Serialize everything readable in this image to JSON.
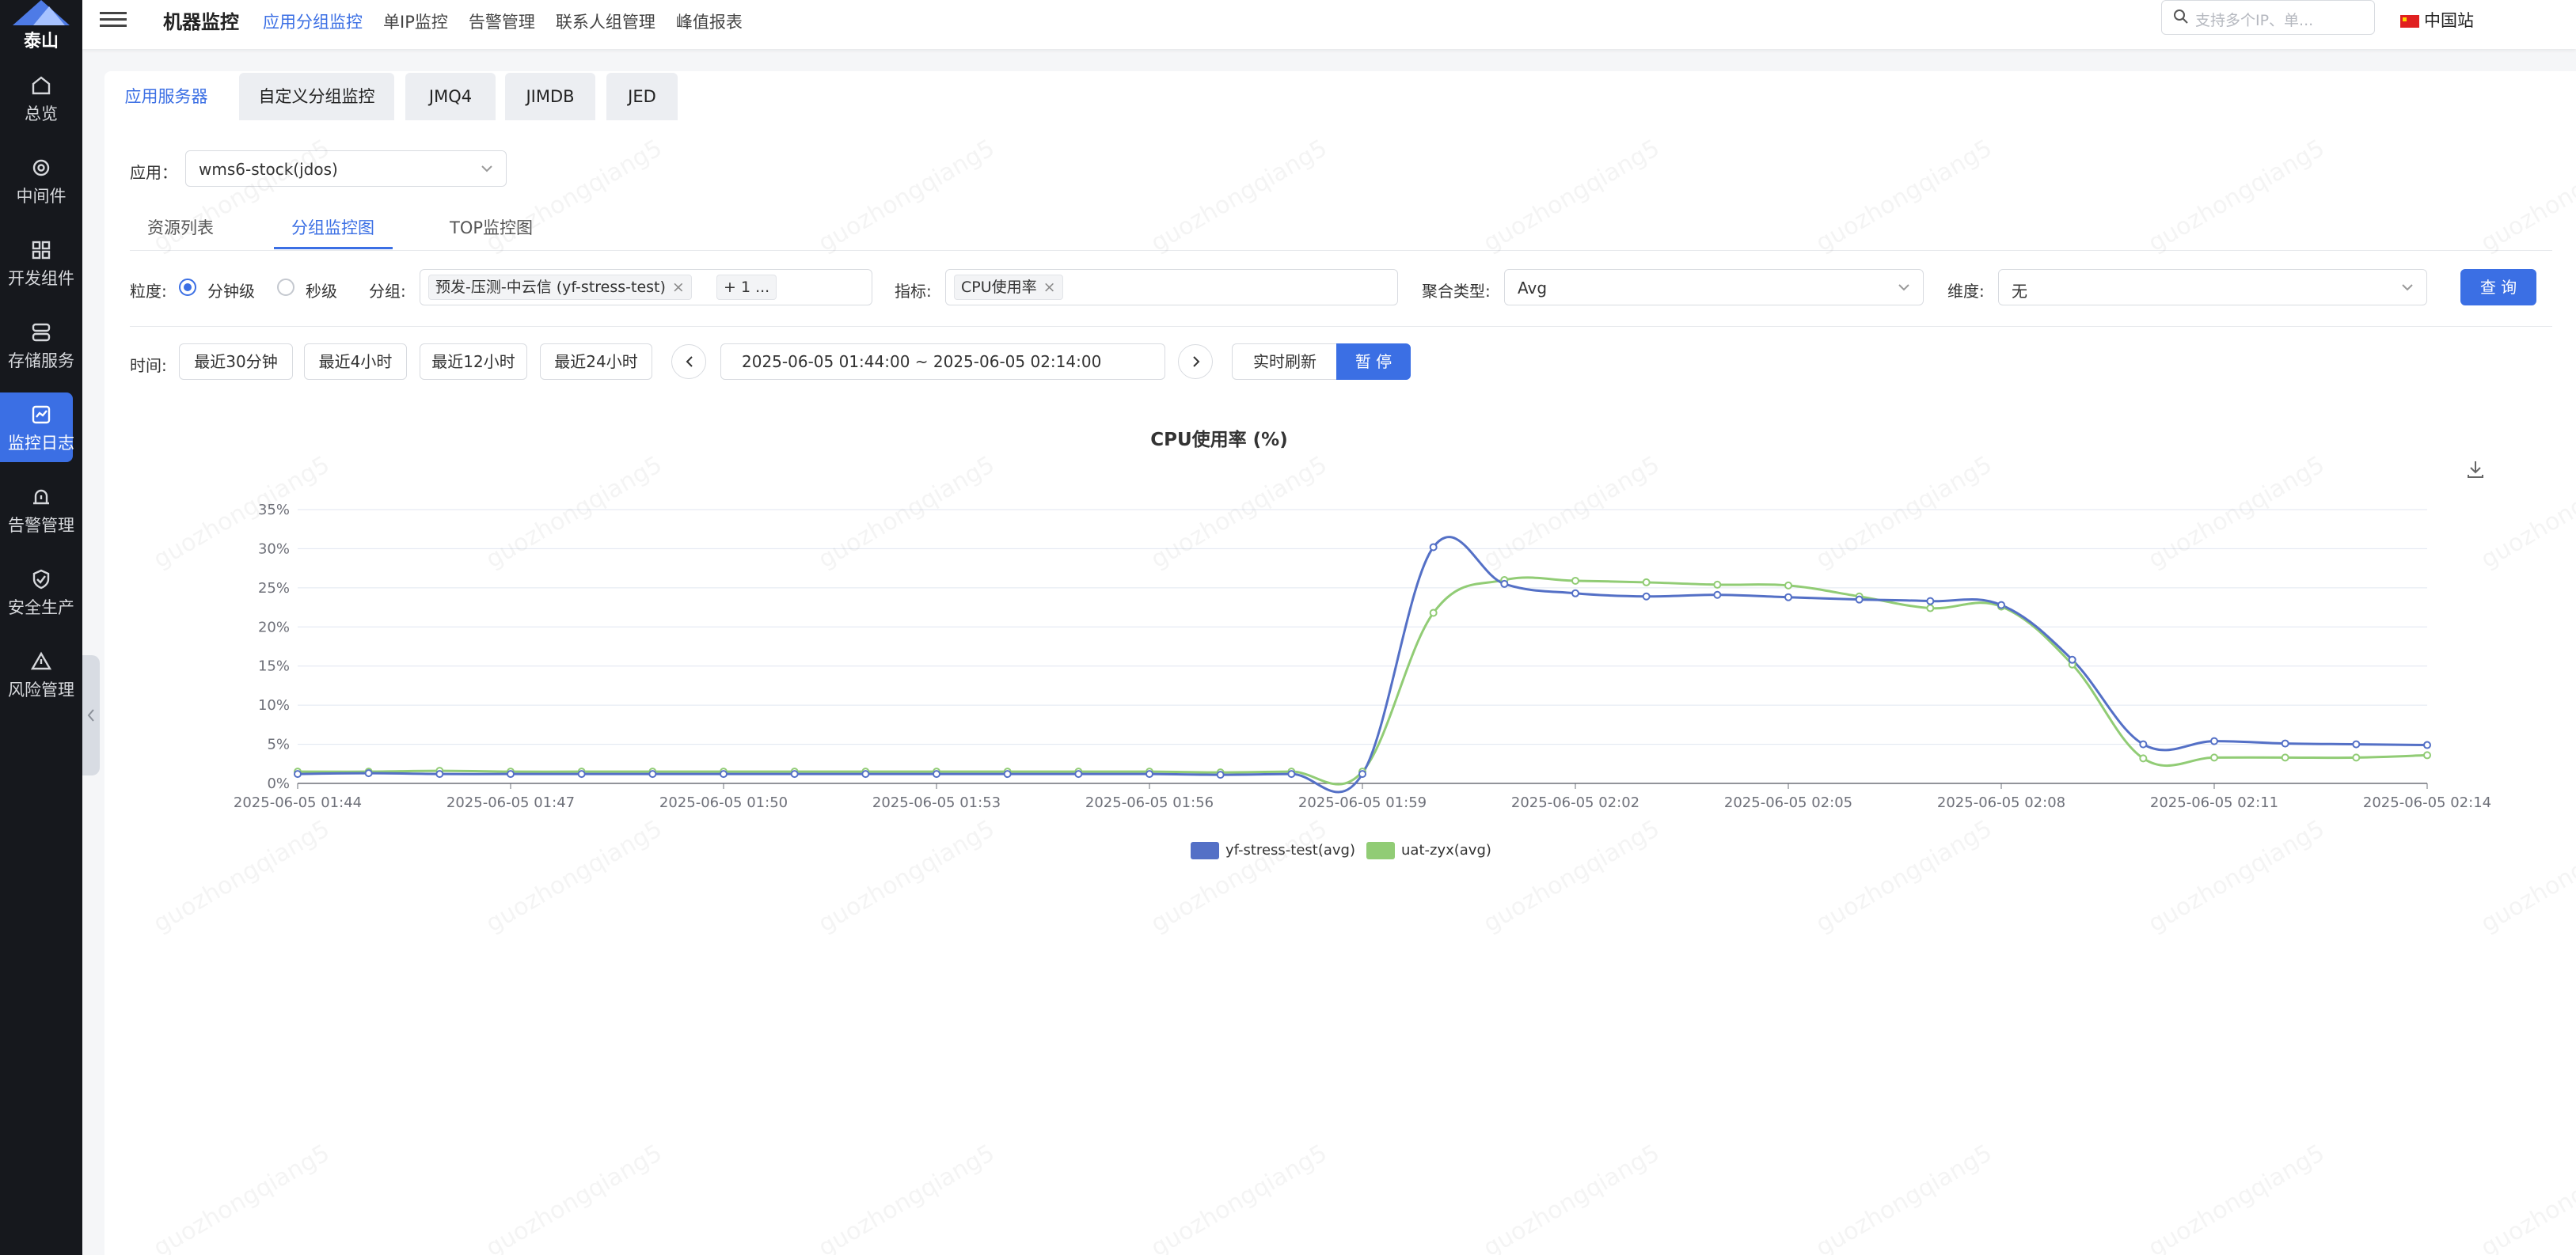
{
  "brand": {
    "logo_text": "泰山"
  },
  "sidebar": {
    "items": [
      {
        "label": "总览",
        "icon": "home-icon"
      },
      {
        "label": "中间件",
        "icon": "middleware-icon"
      },
      {
        "label": "开发组件",
        "icon": "grid-icon"
      },
      {
        "label": "存储服务",
        "icon": "storage-icon"
      },
      {
        "label": "监控日志",
        "icon": "monitor-icon",
        "active": true
      },
      {
        "label": "告警管理",
        "icon": "alarm-icon"
      },
      {
        "label": "安全生产",
        "icon": "shield-icon"
      },
      {
        "label": "风险管理",
        "icon": "warning-icon"
      }
    ]
  },
  "header": {
    "title": "机器监控",
    "nav": [
      "应用分组监控",
      "单IP监控",
      "告警管理",
      "联系人组管理",
      "峰值报表"
    ],
    "active_nav": "应用分组监控",
    "search_placeholder": "支持多个IP、单...",
    "site": "中国站"
  },
  "tabs": [
    "应用服务器",
    "自定义分组监控",
    "JMQ4",
    "JIMDB",
    "JED"
  ],
  "active_tab": "应用服务器",
  "app_field": {
    "label": "应用：",
    "value": "wms6-stock(jdos)"
  },
  "subtabs": [
    "资源列表",
    "分组监控图",
    "TOP监控图"
  ],
  "active_subtab": "分组监控图",
  "filters": {
    "granularity_label": "粒度:",
    "granularity_options": [
      "分钟级",
      "秒级"
    ],
    "granularity_selected": "分钟级",
    "group_label": "分组:",
    "group_tag": "预发-压测-中云信 (yf-stress-test)",
    "group_more": "+ 1 ...",
    "metric_label": "指标:",
    "metric_tag": "CPU使用率",
    "agg_label": "聚合类型:",
    "agg_value": "Avg",
    "dim_label": "维度:",
    "dim_value": "无",
    "query_button": "查 询"
  },
  "time": {
    "label": "时间:",
    "quick": [
      "最近30分钟",
      "最近4小时",
      "最近12小时",
      "最近24小时"
    ],
    "range": "2025-06-05 01:44:00  ~  2025-06-05 02:14:00",
    "realtime": "实时刷新",
    "pause": "暂 停"
  },
  "watermark": "guozhongqiang5",
  "colors": {
    "accent": "#3b6fe4",
    "series1": "#5470c6",
    "series2": "#91cc75"
  },
  "chart_data": {
    "type": "line",
    "title": "CPU使用率 (%)",
    "x": [
      "2025-06-05 01:44",
      "2025-06-05 01:45",
      "2025-06-05 01:46",
      "2025-06-05 01:47",
      "2025-06-05 01:48",
      "2025-06-05 01:49",
      "2025-06-05 01:50",
      "2025-06-05 01:51",
      "2025-06-05 01:52",
      "2025-06-05 01:53",
      "2025-06-05 01:54",
      "2025-06-05 01:55",
      "2025-06-05 01:56",
      "2025-06-05 01:57",
      "2025-06-05 01:58",
      "2025-06-05 01:59",
      "2025-06-05 02:00",
      "2025-06-05 02:01",
      "2025-06-05 02:02",
      "2025-06-05 02:03",
      "2025-06-05 02:04",
      "2025-06-05 02:05",
      "2025-06-05 02:06",
      "2025-06-05 02:07",
      "2025-06-05 02:08",
      "2025-06-05 02:09",
      "2025-06-05 02:10",
      "2025-06-05 02:11",
      "2025-06-05 02:12",
      "2025-06-05 02:13",
      "2025-06-05 02:14"
    ],
    "x_tick_labels": [
      "2025-06-05 01:44",
      "2025-06-05 01:47",
      "2025-06-05 01:50",
      "2025-06-05 01:53",
      "2025-06-05 01:56",
      "2025-06-05 01:59",
      "2025-06-05 02:02",
      "2025-06-05 02:05",
      "2025-06-05 02:08",
      "2025-06-05 02:11",
      "2025-06-05 02:14"
    ],
    "y_tick_labels": [
      "0%",
      "5%",
      "10%",
      "15%",
      "20%",
      "25%",
      "30%",
      "35%"
    ],
    "ylim": [
      0,
      35
    ],
    "series": [
      {
        "name": "yf-stress-test(avg)",
        "color": "#5470c6",
        "values": [
          1.2,
          1.3,
          1.2,
          1.2,
          1.2,
          1.2,
          1.2,
          1.2,
          1.2,
          1.2,
          1.2,
          1.2,
          1.2,
          1.1,
          1.2,
          1.2,
          30.2,
          25.5,
          24.3,
          23.9,
          24.1,
          23.8,
          23.5,
          23.3,
          22.8,
          15.8,
          5.0,
          5.4,
          5.1,
          5.0,
          4.9
        ]
      },
      {
        "name": "uat-zyx(avg)",
        "color": "#91cc75",
        "values": [
          1.5,
          1.5,
          1.6,
          1.5,
          1.5,
          1.5,
          1.5,
          1.5,
          1.5,
          1.5,
          1.5,
          1.5,
          1.5,
          1.4,
          1.5,
          1.5,
          21.8,
          26.0,
          25.9,
          25.7,
          25.4,
          25.3,
          23.9,
          22.4,
          22.6,
          15.2,
          3.2,
          3.3,
          3.3,
          3.3,
          3.6
        ]
      }
    ],
    "legend_position": "bottom-center",
    "grid": true
  }
}
